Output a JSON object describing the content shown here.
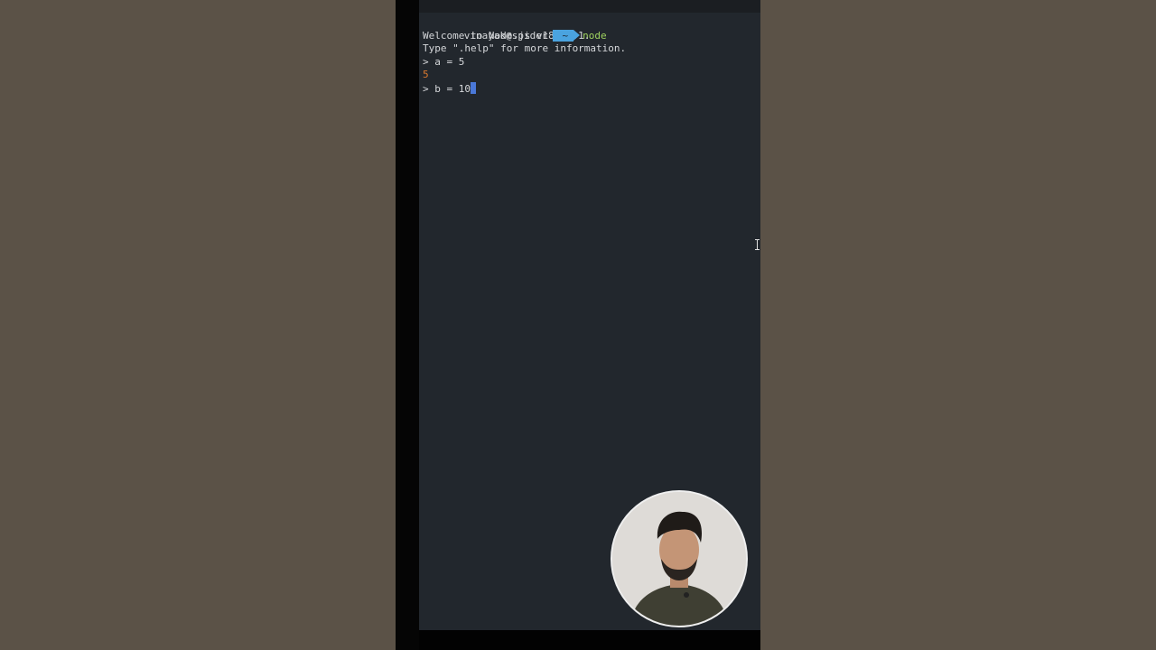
{
  "terminal": {
    "prompt": {
      "user_host": "vinayak@spider",
      "directory": "~",
      "command": "node"
    },
    "lines": [
      "Welcome to Node.js v18.12.1.",
      "Type \".help\" for more information.",
      "> a = 5"
    ],
    "output_value": "5",
    "current_input": "> b = 10"
  },
  "colors": {
    "background": "#5b5247",
    "terminal_bg": "#22272d",
    "prompt_accent": "#4aa3df",
    "command_green": "#9fd35f",
    "result_orange": "#d9792e",
    "cursor_blue": "#4a78d8"
  },
  "icons": {
    "mouse_cursor": "text-ibeam-cursor-icon"
  }
}
